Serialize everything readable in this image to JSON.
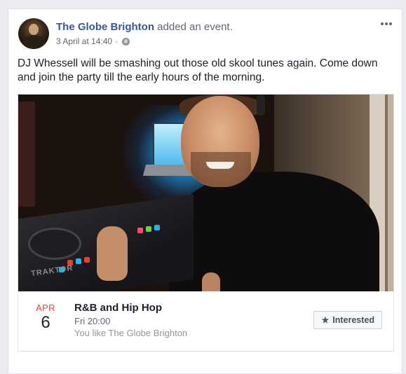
{
  "post": {
    "page_name": "The Globe Brighton",
    "action": "added an event.",
    "timestamp": "3 April at 14:40",
    "separator": "·",
    "privacy_icon": "globe-icon",
    "more_icon": "more-options-icon",
    "text": "DJ Whessell will be smashing out those old skool tunes again. Come down and join the party till the early hours of the morning."
  },
  "event": {
    "cover_label": "TRAKTOR",
    "month": "APR",
    "day": "6",
    "title": "R&B and Hip Hop",
    "time": "Fri 20:00",
    "social_context": "You like The Globe Brighton",
    "interested_label": "Interested",
    "interested_icon": "star-icon"
  },
  "colors": {
    "link": "#365899",
    "month": "#e9453d",
    "page_bg": "#e9ebee"
  }
}
